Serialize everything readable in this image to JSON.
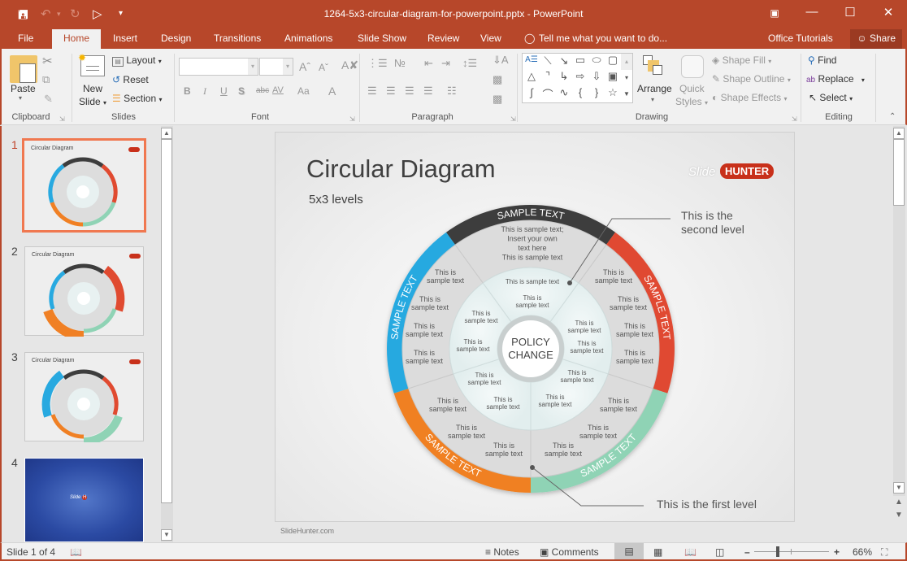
{
  "window": {
    "title": "1264-5x3-circular-diagram-for-powerpoint.pptx - PowerPoint",
    "controls": [
      "ribbon-display-options",
      "minimize",
      "maximize",
      "close"
    ]
  },
  "qat": {
    "icons": [
      "save-icon",
      "undo-icon",
      "redo-icon",
      "start-from-beginning-icon",
      "customize-qat-icon"
    ]
  },
  "tabs": [
    "File",
    "Home",
    "Insert",
    "Design",
    "Transitions",
    "Animations",
    "Slide Show",
    "Review",
    "View"
  ],
  "active_tab": "Home",
  "tell_me": "Tell me what you want to do...",
  "account": "Office Tutorials",
  "share": "Share",
  "ribbon": {
    "clipboard": {
      "label": "Clipboard",
      "paste": "Paste"
    },
    "slides": {
      "label": "Slides",
      "new_slide_1": "New",
      "new_slide_2": "Slide",
      "layout": "Layout",
      "reset": "Reset",
      "section": "Section"
    },
    "font": {
      "label": "Font",
      "font_name": "",
      "font_size": "",
      "bold": "B",
      "italic": "I",
      "underline": "U",
      "shadow": "S",
      "strike": "abc",
      "spacing": "AV",
      "case": "Aa"
    },
    "paragraph": {
      "label": "Paragraph"
    },
    "drawing": {
      "label": "Drawing",
      "arrange": "Arrange",
      "quick_styles_1": "Quick",
      "quick_styles_2": "Styles",
      "shape_fill": "Shape Fill",
      "shape_outline": "Shape Outline",
      "shape_effects": "Shape Effects"
    },
    "editing": {
      "label": "Editing",
      "find": "Find",
      "replace": "Replace",
      "select": "Select"
    }
  },
  "thumbnails": [
    {
      "num": "1",
      "title": "Circular Diagram",
      "selected": true
    },
    {
      "num": "2",
      "title": "Circular Diagram",
      "selected": false
    },
    {
      "num": "3",
      "title": "Circular Diagram",
      "selected": false
    },
    {
      "num": "4",
      "title": "",
      "selected": false
    }
  ],
  "slide": {
    "title": "Circular Diagram",
    "subtitle": "5x3 levels",
    "logo_left": "Slide",
    "logo_right": "HUNTER",
    "footer": "SlideHunter.com",
    "center": [
      "POLICY",
      "CHANGE"
    ],
    "callout_second": [
      "This is the",
      "second level"
    ],
    "callout_first": "This is the first level",
    "outer_ring": [
      {
        "label": "SAMPLE TEXT",
        "color": "#3d3d3d"
      },
      {
        "label": "SAMPLE TEXT",
        "color": "#e04a30"
      },
      {
        "label": "SAMPLE TEXT",
        "color": "#8fd3b5"
      },
      {
        "label": "SAMPLE TEXT",
        "color": "#f08024"
      },
      {
        "label": "SAMPLE TEXT",
        "color": "#28a9e0"
      }
    ],
    "middle_top": [
      "This is sample text;",
      "Insert your own",
      "text here",
      "This is sample text"
    ],
    "middle_texts": [
      "This is",
      "sample text"
    ],
    "inner_top": "This is sample text",
    "inner_text": [
      "This is",
      "sample text"
    ]
  },
  "status": {
    "slide_of": "Slide 1 of 4",
    "notes": "Notes",
    "comments": "Comments",
    "zoom": "66%",
    "zoom_level_percent": 66
  }
}
